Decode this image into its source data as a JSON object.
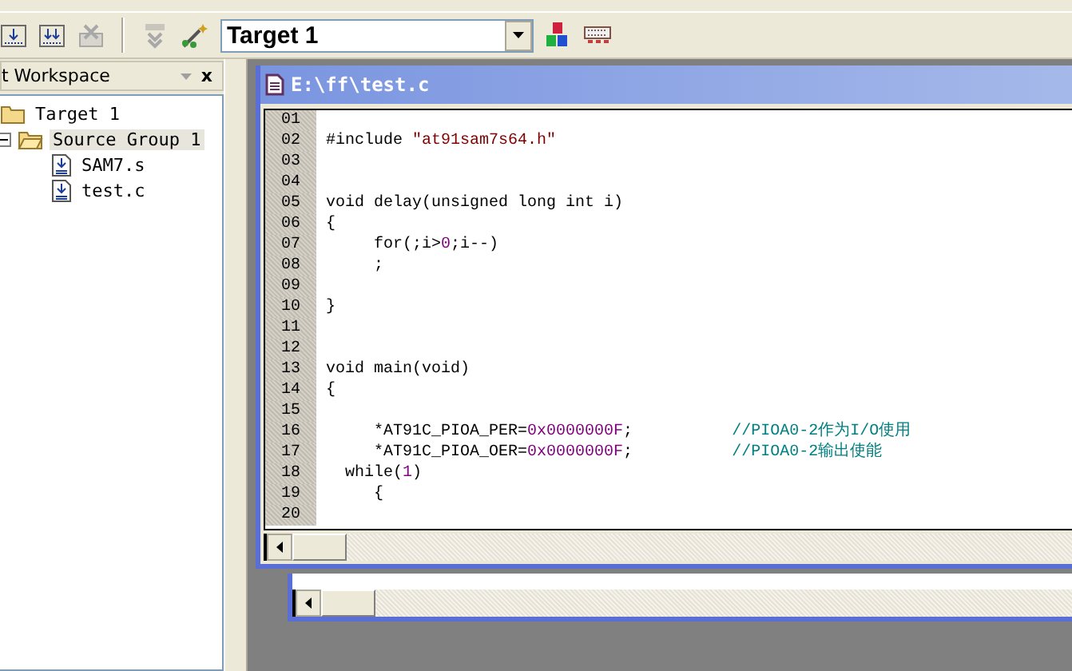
{
  "toolbar": {
    "target_select": {
      "value": "Target 1"
    }
  },
  "workspace": {
    "title": "t Workspace",
    "close": "x",
    "tree": [
      {
        "label": "Target 1",
        "kind": "target",
        "selected": false,
        "children": [
          {
            "label": "Source Group 1",
            "kind": "group",
            "selected": true,
            "expanded": true,
            "children": [
              {
                "label": "SAM7.s",
                "kind": "file",
                "selected": false
              },
              {
                "label": "test.c",
                "kind": "file",
                "selected": false
              }
            ]
          }
        ]
      }
    ]
  },
  "editor": {
    "title": "E:\\ff\\test.c",
    "lines": [
      {
        "number": "01"
      },
      {
        "number": "02",
        "tokens": [
          {
            "kind": "plain",
            "text": "#include "
          },
          {
            "kind": "string",
            "text": "\"at91sam7s64.h\""
          }
        ]
      },
      {
        "number": "03"
      },
      {
        "number": "04"
      },
      {
        "number": "05",
        "tokens": [
          {
            "kind": "plain",
            "text": "void delay(unsigned long int i)"
          }
        ]
      },
      {
        "number": "06",
        "tokens": [
          {
            "kind": "plain",
            "text": "{"
          }
        ]
      },
      {
        "number": "07",
        "tokens": [
          {
            "kind": "plain",
            "text": "     for(;i>"
          },
          {
            "kind": "number",
            "text": "0"
          },
          {
            "kind": "plain",
            "text": ";i--)"
          }
        ]
      },
      {
        "number": "08",
        "tokens": [
          {
            "kind": "plain",
            "text": "     ;"
          }
        ]
      },
      {
        "number": "09"
      },
      {
        "number": "10",
        "tokens": [
          {
            "kind": "plain",
            "text": "}"
          }
        ]
      },
      {
        "number": "11"
      },
      {
        "number": "12"
      },
      {
        "number": "13",
        "tokens": [
          {
            "kind": "plain",
            "text": "void main(void)"
          }
        ]
      },
      {
        "number": "14",
        "tokens": [
          {
            "kind": "plain",
            "text": "{"
          }
        ]
      },
      {
        "number": "15"
      },
      {
        "number": "16",
        "tokens": [
          {
            "kind": "plain",
            "text": "     *AT91C_PIOA_PER="
          },
          {
            "kind": "number",
            "text": "0x0000000F"
          },
          {
            "kind": "plain",
            "text": ";"
          },
          {
            "kind": "comment",
            "text": "//PIOA0-2作为I/O使用"
          }
        ]
      },
      {
        "number": "17",
        "tokens": [
          {
            "kind": "plain",
            "text": "     *AT91C_PIOA_OER="
          },
          {
            "kind": "number",
            "text": "0x0000000F"
          },
          {
            "kind": "plain",
            "text": ";"
          },
          {
            "kind": "comment",
            "text": "//PIOA0-2输出使能"
          }
        ]
      },
      {
        "number": "18",
        "tokens": [
          {
            "kind": "plain",
            "text": "  while("
          },
          {
            "kind": "number",
            "text": "1"
          },
          {
            "kind": "plain",
            "text": ")"
          }
        ]
      },
      {
        "number": "19",
        "tokens": [
          {
            "kind": "plain",
            "text": "     {"
          }
        ]
      },
      {
        "number": "20"
      }
    ]
  }
}
